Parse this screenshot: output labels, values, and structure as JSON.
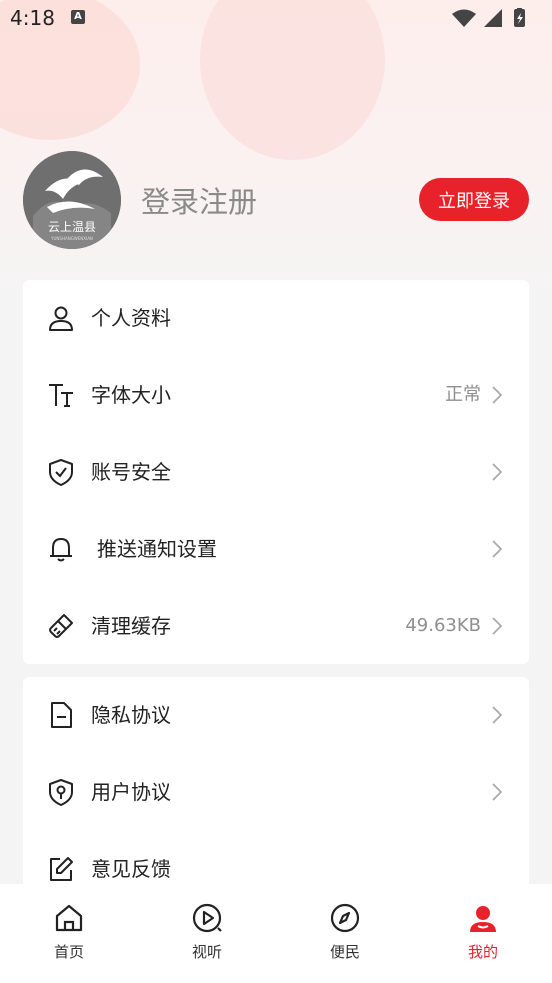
{
  "status_bar": {
    "time": "4:18",
    "notification_badge": "A"
  },
  "header": {
    "avatar_text": "云上温县",
    "avatar_subtext": "YUNSHANGWENXIAN",
    "login_register_label": "登录注册",
    "login_button_label": "立即登录"
  },
  "settings_group_1": [
    {
      "icon": "user-icon",
      "label": "个人资料",
      "value": ""
    },
    {
      "icon": "font-size-icon",
      "label": "字体大小",
      "value": "正常"
    },
    {
      "icon": "shield-check-icon",
      "label": "账号安全",
      "value": ""
    },
    {
      "icon": "bell-icon",
      "label": "推送通知设置",
      "value": ""
    },
    {
      "icon": "broom-icon",
      "label": "清理缓存",
      "value": "49.63KB"
    }
  ],
  "settings_group_2": [
    {
      "icon": "document-icon",
      "label": "隐私协议",
      "value": ""
    },
    {
      "icon": "shield-location-icon",
      "label": "用户协议",
      "value": ""
    },
    {
      "icon": "edit-icon",
      "label": "意见反馈",
      "value": ""
    }
  ],
  "tabbar": [
    {
      "icon": "home-icon",
      "label": "首页"
    },
    {
      "icon": "play-circle-icon",
      "label": "视听"
    },
    {
      "icon": "compass-icon",
      "label": "便民"
    },
    {
      "icon": "person-icon",
      "label": "我的"
    }
  ],
  "colors": {
    "accent": "#e8222a",
    "text": "#222222",
    "muted": "#8f8f8f",
    "background": "#f4f4f4"
  }
}
